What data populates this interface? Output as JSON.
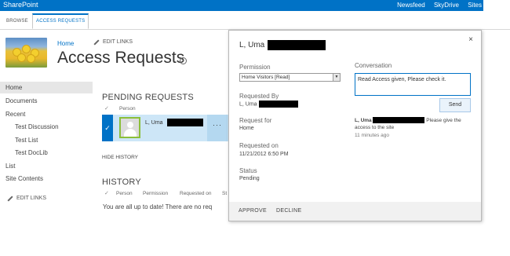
{
  "suite_bar": {
    "brand": "SharePoint",
    "links": [
      "Newsfeed",
      "SkyDrive",
      "Sites"
    ]
  },
  "ribbon": {
    "tabs": [
      "BROWSE",
      "ACCESS REQUESTS"
    ],
    "active_tab": "ACCESS REQUESTS"
  },
  "header": {
    "home_link": "Home",
    "edit_links": "EDIT LINKS",
    "page_title": "Access Requests",
    "info_icon": "i"
  },
  "quick_launch": {
    "items": [
      "Home",
      "Documents",
      "Recent",
      "Test Discussion",
      "Test List",
      "Test DocLib",
      "List",
      "Site Contents"
    ],
    "edit_links": "EDIT LINKS",
    "selected": "Home"
  },
  "pending": {
    "heading": "PENDING REQUESTS",
    "columns": [
      "Person"
    ],
    "row": {
      "name": "L, Uma",
      "more": "···"
    },
    "hide_history": "HIDE HISTORY"
  },
  "history": {
    "heading": "HISTORY",
    "columns": [
      "Person",
      "Permission",
      "Requested on",
      "St"
    ],
    "empty_text": "You are all up to date! There are no req"
  },
  "callout": {
    "title": "L, Uma",
    "close": "×",
    "permission_label": "Permission",
    "permission_value": "Home Visitors [Read]",
    "requested_by_label": "Requested By",
    "requested_by_value": "L, Uma",
    "request_for_label": "Request for",
    "request_for_value": "Home",
    "requested_on_label": "Requested on",
    "requested_on_value": "11/21/2012 6:50 PM",
    "status_label": "Status",
    "status_value": "Pending",
    "conversation_label": "Conversation",
    "conversation_input": "Read Access given, Please check it.",
    "send_label": "Send",
    "message": {
      "author": "L, Uma",
      "text": "Please give the access to the site",
      "time": "11 minutes ago"
    },
    "approve_label": "APPROVE",
    "decline_label": "DECLINE"
  },
  "colors": {
    "suite_bar": "#0072c6",
    "selection": "#cde6f7",
    "accent": "#0072c6"
  },
  "icons": [
    "pencil-icon",
    "info-icon",
    "close-icon",
    "checkmark-icon",
    "person-placeholder-icon",
    "dropdown-arrow-icon"
  ]
}
